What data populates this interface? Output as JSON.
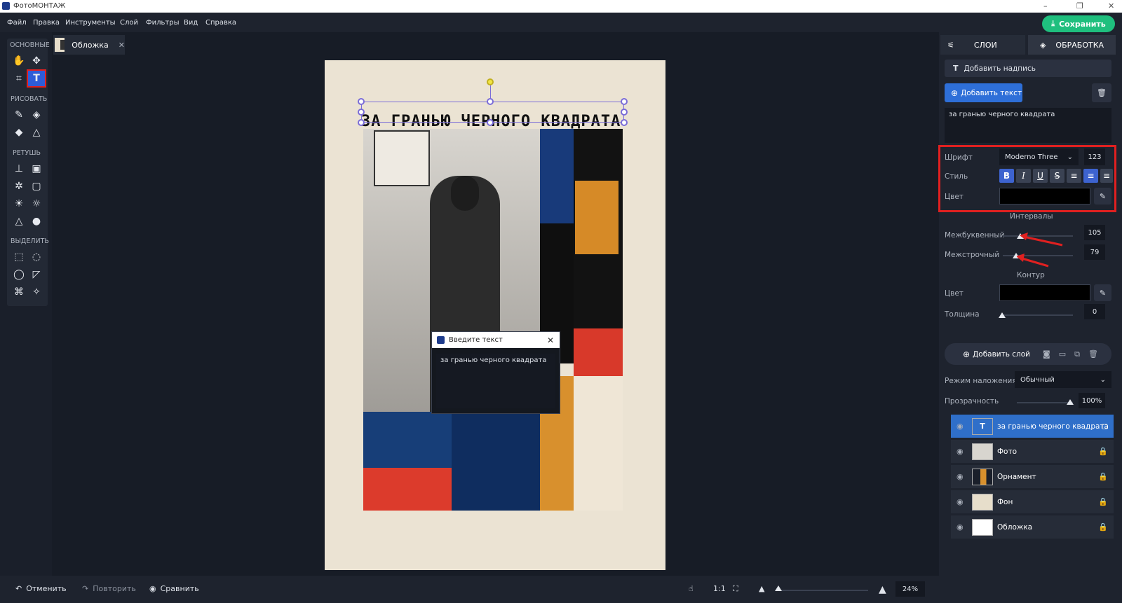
{
  "window": {
    "title": "ФотоМОНТАЖ",
    "minimize": "–",
    "restore": "❐",
    "close": "✕"
  },
  "menu": [
    "Файл",
    "Правка",
    "Инструменты",
    "Слой",
    "Фильтры",
    "Вид",
    "Справка"
  ],
  "save_label": "Сохранить",
  "toolbar": {
    "sections": [
      "ОСНОВНЫЕ",
      "РИСОВАТЬ",
      "РЕТУШЬ",
      "ВЫДЕЛИТЬ"
    ]
  },
  "doc_tab": {
    "name": "Обложка",
    "close": "✕"
  },
  "canvas": {
    "headline": "ЗА ГРАНЬЮ ЧЕРНОГО КВАДРАТА"
  },
  "dialog": {
    "title": "Введите текст",
    "text": "за гранью черного квадрата",
    "close": "✕"
  },
  "bottom": {
    "undo": "Отменить",
    "redo": "Повторить",
    "compare": "Сравнить",
    "ratio": "1:1",
    "zoom": "24%"
  },
  "panel": {
    "tabs": [
      "СЛОИ",
      "ОБРАБОТКА"
    ],
    "add_caption": "Добавить надпись",
    "add_text": "Добавить текст",
    "text_value": "за гранью черного квадрата",
    "font_label": "Шрифт",
    "font_value": "Moderno Three",
    "font_size": "123",
    "style_label": "Стиль",
    "color_label": "Цвет",
    "intervals": "Интервалы",
    "letter_label": "Межбуквенный",
    "letter_value": "105",
    "line_label": "Межстрочный",
    "line_value": "79",
    "contour": "Контур",
    "contour_color_label": "Цвет",
    "thickness_label": "Толщина",
    "thickness_value": "0",
    "add_layer": "Добавить слой",
    "blend_label": "Режим наложения:",
    "blend_value": "Обычный",
    "opacity_label": "Прозрачность",
    "opacity_value": "100%"
  },
  "layers": [
    {
      "name": "за гранью черного квадрата"
    },
    {
      "name": "Фото"
    },
    {
      "name": "Орнамент"
    },
    {
      "name": "Фон"
    },
    {
      "name": "Обложка"
    }
  ],
  "colors": {
    "accent": "#2e5cd8",
    "save": "#1fbf7e",
    "highlight": "#e02020",
    "layer_selected": "#2f6fc9"
  }
}
